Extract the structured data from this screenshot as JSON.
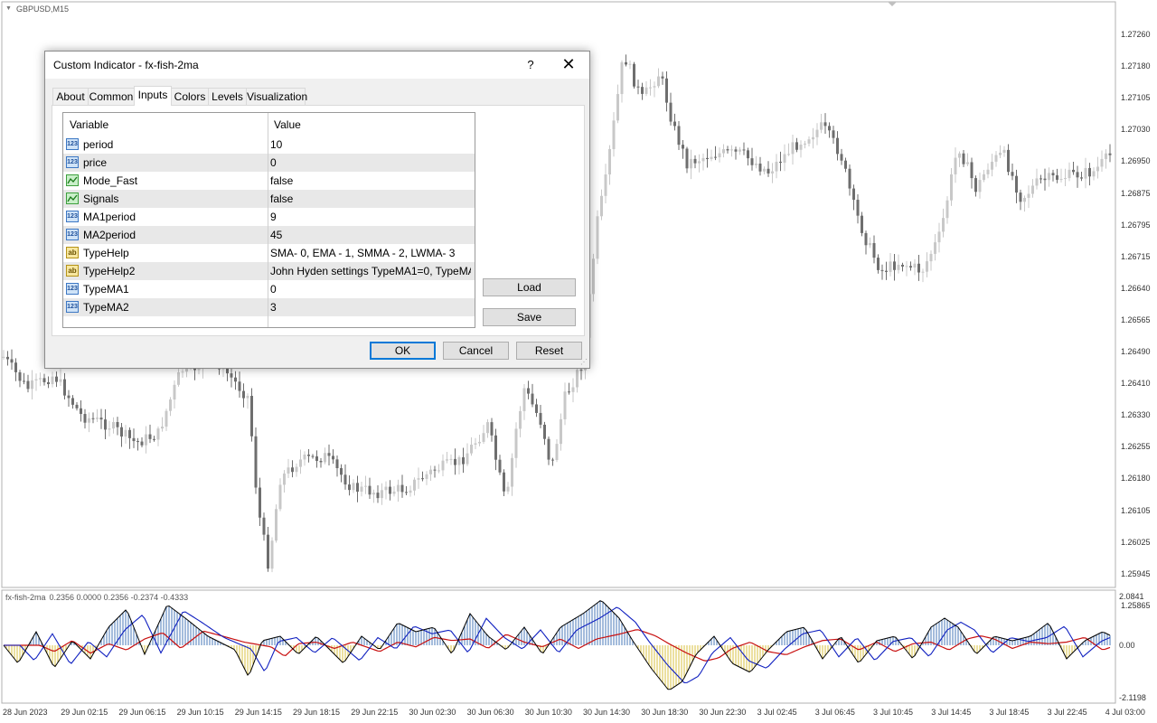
{
  "chart": {
    "symbol": "GBPUSD,M15",
    "price_axis": [
      "1.27260",
      "1.27180",
      "1.27105",
      "1.27030",
      "1.26950",
      "1.26875",
      "1.26795",
      "1.26715",
      "1.26640",
      "1.26565",
      "1.26490",
      "1.26410",
      "1.26330",
      "1.26255",
      "1.26180",
      "1.26105",
      "1.26025",
      "1.25945",
      "1.25865"
    ],
    "time_axis": [
      "28 Jun 2023",
      "29 Jun 02:15",
      "29 Jun 06:15",
      "29 Jun 10:15",
      "29 Jun 14:15",
      "29 Jun 18:15",
      "29 Jun 22:15",
      "30 Jun 02:30",
      "30 Jun 06:30",
      "30 Jun 10:30",
      "30 Jun 14:30",
      "30 Jun 18:30",
      "30 Jun 22:30",
      "3 Jul 02:45",
      "3 Jul 06:45",
      "3 Jul 10:45",
      "3 Jul 14:45",
      "3 Jul 18:45",
      "3 Jul 22:45",
      "4 Jul 03:00"
    ],
    "colors": {
      "bull": "#c8c8c8",
      "bear": "#6e6e6e",
      "bg": "#ffffff"
    }
  },
  "indicator": {
    "name": "fx-fish-2ma",
    "values": "0.2356 0.0000 0.2356 -0.2374 -0.4333",
    "scale": [
      "2.0841",
      "0.00",
      "-2.1198"
    ],
    "colors": {
      "pos_hist": "#4a7ab8",
      "neg_hist": "#d8c040",
      "fish": "#000000",
      "ma1": "#1020c0",
      "ma2": "#c81010"
    }
  },
  "dialog": {
    "title": "Custom Indicator - fx-fish-2ma",
    "help": "?",
    "close": "✕",
    "tabs": [
      "About",
      "Common",
      "Inputs",
      "Colors",
      "Levels",
      "Visualization"
    ],
    "active_tab": "Inputs",
    "grid": {
      "headers": {
        "variable": "Variable",
        "value": "Value"
      },
      "rows": [
        {
          "icon": "123",
          "name": "period",
          "value": "10"
        },
        {
          "icon": "123",
          "name": "price",
          "value": "0"
        },
        {
          "icon": "bool",
          "name": "Mode_Fast",
          "value": "false"
        },
        {
          "icon": "bool",
          "name": "Signals",
          "value": "false"
        },
        {
          "icon": "123",
          "name": "MA1period",
          "value": "9"
        },
        {
          "icon": "123",
          "name": "MA2period",
          "value": "45"
        },
        {
          "icon": "ab",
          "name": "TypeHelp",
          "value": "SMA- 0, EMA - 1, SMMA - 2, LWMA- 3"
        },
        {
          "icon": "ab",
          "name": "TypeHelp2",
          "value": "John Hyden settings TypeMA1=0, TypeMA..."
        },
        {
          "icon": "123",
          "name": "TypeMA1",
          "value": "0"
        },
        {
          "icon": "123",
          "name": "TypeMA2",
          "value": "3"
        }
      ]
    },
    "buttons": {
      "load": "Load",
      "save": "Save",
      "ok": "OK",
      "cancel": "Cancel",
      "reset": "Reset"
    }
  }
}
